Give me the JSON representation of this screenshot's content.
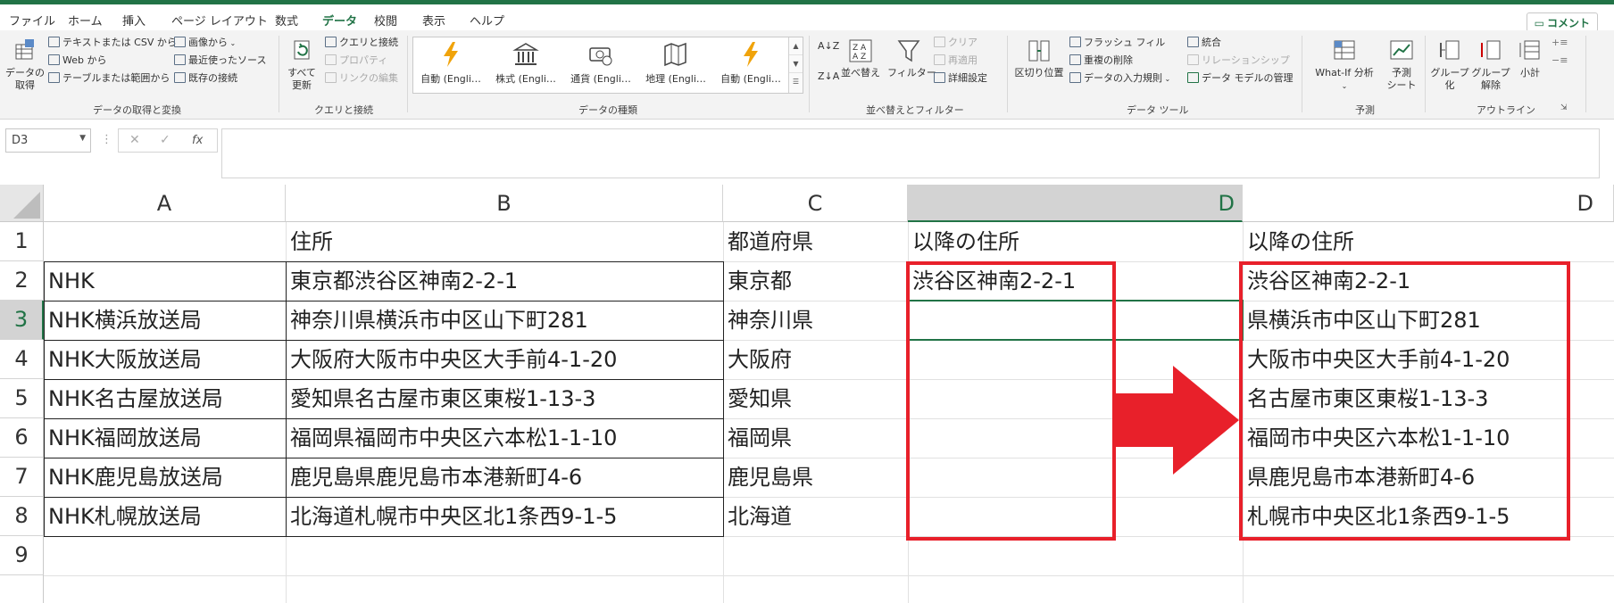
{
  "tabs": [
    "ファイル",
    "ホーム",
    "挿入",
    "ページ レイアウト",
    "数式",
    "データ",
    "校閲",
    "表示",
    "ヘルプ"
  ],
  "active_tab": "データ",
  "comment_button": "コメント",
  "ribbon": {
    "get_data": {
      "big_label": "データの\n取得",
      "items": [
        "テキストまたは CSV から",
        "Web から",
        "テーブルまたは範囲から",
        "画像から",
        "最近使ったソース",
        "既存の接続"
      ],
      "group_label": "データの取得と変換"
    },
    "queries": {
      "refresh_label": "すべて\n更新",
      "items": [
        "クエリと接続",
        "プロパティ",
        "リンクの編集"
      ],
      "group_label": "クエリと接続"
    },
    "data_types": {
      "items": [
        "自動 (Engli…",
        "株式 (Engli…",
        "通貨 (Engli…",
        "地理 (Engli…",
        "自動 (Engli…"
      ],
      "group_label": "データの種類"
    },
    "sort_filter": {
      "sort_label": "並べ替え",
      "filter_label": "フィルター",
      "items": [
        "クリア",
        "再適用",
        "詳細設定"
      ],
      "group_label": "並べ替えとフィルター"
    },
    "data_tools": {
      "split_label": "区切り位置",
      "items": [
        "フラッシュ フィル",
        "重複の削除",
        "データの入力規則",
        "統合",
        "リレーションシップ",
        "データ モデルの管理"
      ],
      "group_label": "データ ツール"
    },
    "forecast": {
      "whatif_label": "What-If 分析",
      "sheet_label": "予測\nシート",
      "group_label": "予測"
    },
    "outline": {
      "group_label_btn": "グループ\n化",
      "ungroup_label": "グループ\n解除",
      "subtotal_label": "小計",
      "group_label": "アウトライン"
    }
  },
  "formula_bar": {
    "name_box": "D3",
    "cancel": "✕",
    "enter": "✓",
    "fx": "fx",
    "value": ""
  },
  "columns": [
    "A",
    "B",
    "C",
    "D",
    "D"
  ],
  "rows": [
    "1",
    "2",
    "3",
    "4",
    "5",
    "6",
    "7",
    "8",
    "9"
  ],
  "cells": {
    "header": [
      "",
      "住所",
      "都道府県",
      "以降の住所",
      "以降の住所"
    ],
    "data": [
      [
        "NHK",
        "東京都渋谷区神南2-2-1",
        "東京都",
        "渋谷区神南2-2-1",
        "渋谷区神南2-2-1"
      ],
      [
        "NHK横浜放送局",
        "神奈川県横浜市中区山下町281",
        "神奈川県",
        "",
        "県横浜市中区山下町281"
      ],
      [
        "NHK大阪放送局",
        "大阪府大阪市中央区大手前4-1-20",
        "大阪府",
        "",
        "大阪市中央区大手前4-1-20"
      ],
      [
        "NHK名古屋放送局",
        "愛知県名古屋市東区東桜1-13-3",
        "愛知県",
        "",
        "名古屋市東区東桜1-13-3"
      ],
      [
        "NHK福岡放送局",
        "福岡県福岡市中央区六本松1-1-10",
        "福岡県",
        "",
        "福岡市中央区六本松1-1-10"
      ],
      [
        "NHK鹿児島放送局",
        "鹿児島県鹿児島市本港新町4-6",
        "鹿児島県",
        "",
        "県鹿児島市本港新町4-6"
      ],
      [
        "NHK札幌放送局",
        "北海道札幌市中央区北1条西9-1-5",
        "北海道",
        "",
        "札幌市中央区北1条西9-1-5"
      ]
    ]
  },
  "selected_cell": "D3",
  "colors": {
    "excel_green": "#217346",
    "highlight_red": "#e8202a",
    "header_selected": "#d3d3d3"
  }
}
